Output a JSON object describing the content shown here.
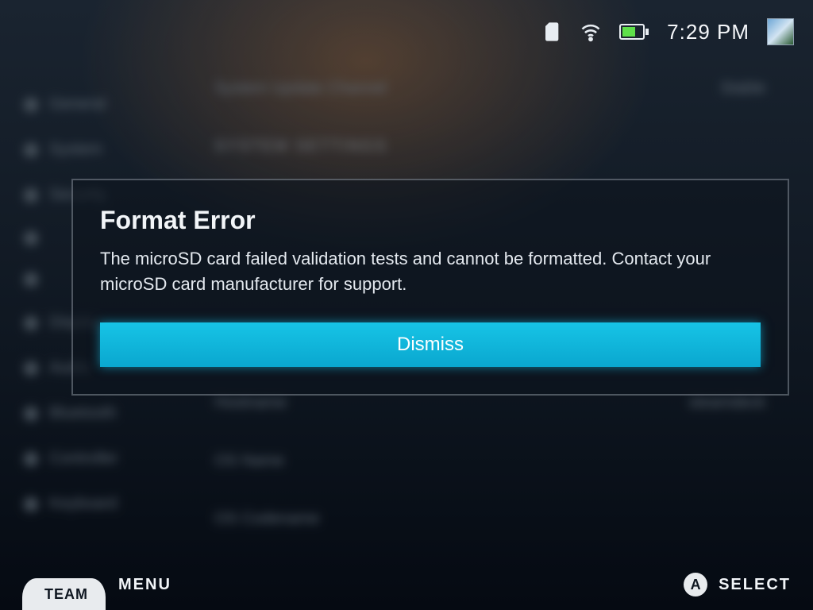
{
  "statusbar": {
    "time": "7:29 PM",
    "icons": {
      "sd": "sd-card-icon",
      "wifi": "wifi-icon",
      "battery": "battery-icon"
    }
  },
  "background": {
    "heading_top": "System Update Channel",
    "value_top": "Stable",
    "section": "SYSTEM SETTINGS",
    "sidebar": [
      "General",
      "System",
      "Security",
      "",
      "",
      "Display",
      "Audio",
      "Bluetooth",
      "Controller",
      "Keyboard"
    ],
    "rows": [
      {
        "l": "Hostname",
        "r": "steamdeck"
      },
      {
        "l": "OS Name",
        "r": ""
      },
      {
        "l": "OS Codename",
        "r": ""
      }
    ]
  },
  "modal": {
    "title": "Format Error",
    "body": "The microSD card failed validation tests and cannot be formatted. Contact your microSD card manufacturer for support.",
    "dismiss": "Dismiss"
  },
  "footer": {
    "steam": "TEAM",
    "menu": "MENU",
    "a_glyph": "A",
    "select": "SELECT"
  }
}
